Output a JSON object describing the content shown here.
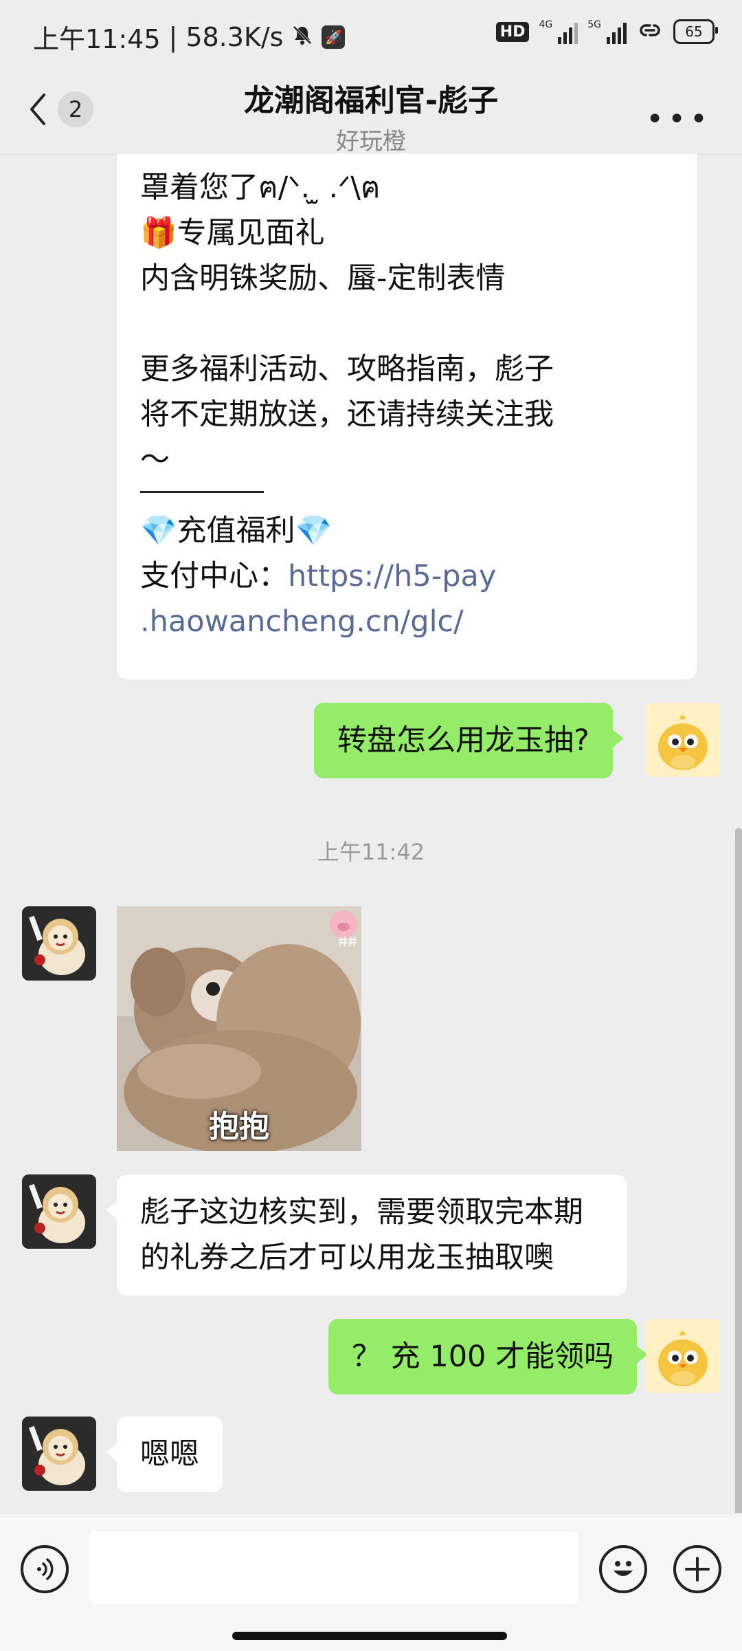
{
  "status_bar": {
    "time": "上午11:45",
    "separator": "|",
    "speed": "58.3K/s",
    "hd": "HD",
    "net1": "4G",
    "net2": "5G",
    "battery": "65"
  },
  "header": {
    "back_count": "2",
    "title": "龙潮阁福利官-彪子",
    "subtitle": "好玩橙"
  },
  "messages": {
    "m1": {
      "line1": "罩着您了ฅ/ᐠ. ̫ .ᐟ\\ฅ",
      "line2": "🎁专属见面礼",
      "line3": "内含明铢奖励、蜃-定制表情",
      "line4": "更多福利活动、攻略指南，彪子",
      "line5": "将不定期放送，还请持续关注我",
      "line6": "～",
      "line7": "💎充值福利💎",
      "line8_prefix": "支付中心：",
      "line8_link": "https://h5-pay",
      "line9_link": ".haowancheng.cn/glc/"
    },
    "m2": "转盘怎么用龙玉抽?",
    "timestamp": "上午11:42",
    "sticker_caption": "抱抱",
    "sticker_badge": "井井",
    "m3_line1": "彪子这边核实到，需要领取完本期",
    "m3_line2": "的礼券之后才可以用龙玉抽取噢",
    "m4": "？ 充 100 才能领吗",
    "m5": "嗯嗯"
  },
  "input": {
    "value": ""
  }
}
